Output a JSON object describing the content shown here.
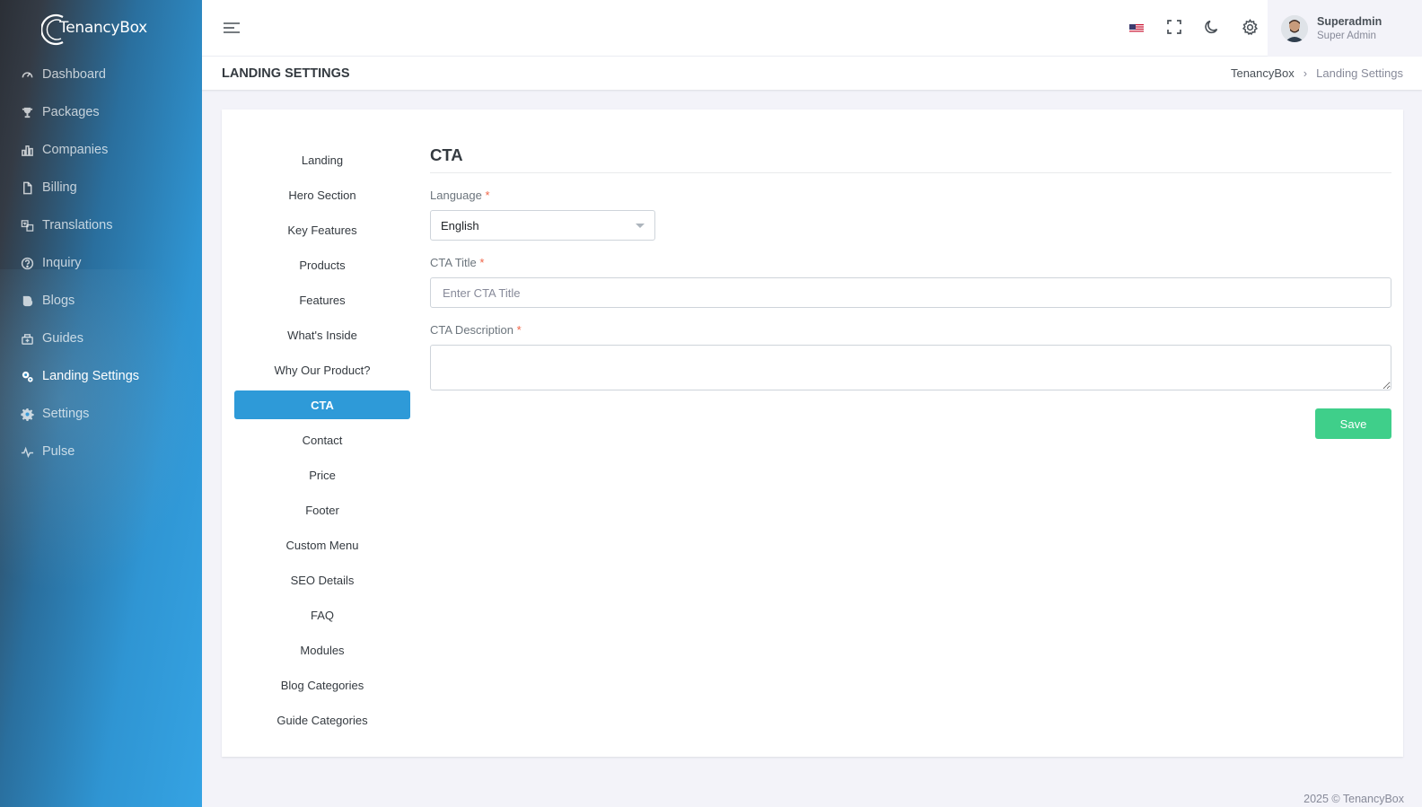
{
  "brand": {
    "name": "TenancyBox"
  },
  "sidebar": {
    "items": [
      {
        "label": "Dashboard",
        "icon": "dashboard-icon"
      },
      {
        "label": "Packages",
        "icon": "trophy-icon"
      },
      {
        "label": "Companies",
        "icon": "bar-chart-icon"
      },
      {
        "label": "Billing",
        "icon": "file-icon"
      },
      {
        "label": "Translations",
        "icon": "translate-icon"
      },
      {
        "label": "Inquiry",
        "icon": "question-icon"
      },
      {
        "label": "Blogs",
        "icon": "blog-icon"
      },
      {
        "label": "Guides",
        "icon": "guide-icon"
      },
      {
        "label": "Landing Settings",
        "icon": "settings-gears-icon",
        "active": true
      },
      {
        "label": "Settings",
        "icon": "gear-icon"
      },
      {
        "label": "Pulse",
        "icon": "pulse-icon"
      }
    ]
  },
  "topbar": {
    "user_name": "Superadmin",
    "user_role": "Super Admin"
  },
  "page": {
    "title": "LANDING SETTINGS",
    "breadcrumb_root": "TenancyBox",
    "breadcrumb_current": "Landing Settings"
  },
  "tabs": [
    "Landing",
    "Hero Section",
    "Key Features",
    "Products",
    "Features",
    "What's Inside",
    "Why Our Product?",
    "CTA",
    "Contact",
    "Price",
    "Footer",
    "Custom Menu",
    "SEO Details",
    "FAQ",
    "Modules",
    "Blog Categories",
    "Guide Categories"
  ],
  "form": {
    "title": "CTA",
    "language_label": "Language",
    "language_value": "English",
    "cta_title_label": "CTA Title",
    "cta_title_placeholder": "Enter CTA Title",
    "cta_title_value": "",
    "cta_description_label": "CTA Description",
    "required_mark": "*",
    "save_label": "Save"
  },
  "footer": {
    "text": "2025 © TenancyBox"
  },
  "colors": {
    "accent": "#2e9ad8",
    "save": "#3fcf8a",
    "required": "#f06548"
  }
}
